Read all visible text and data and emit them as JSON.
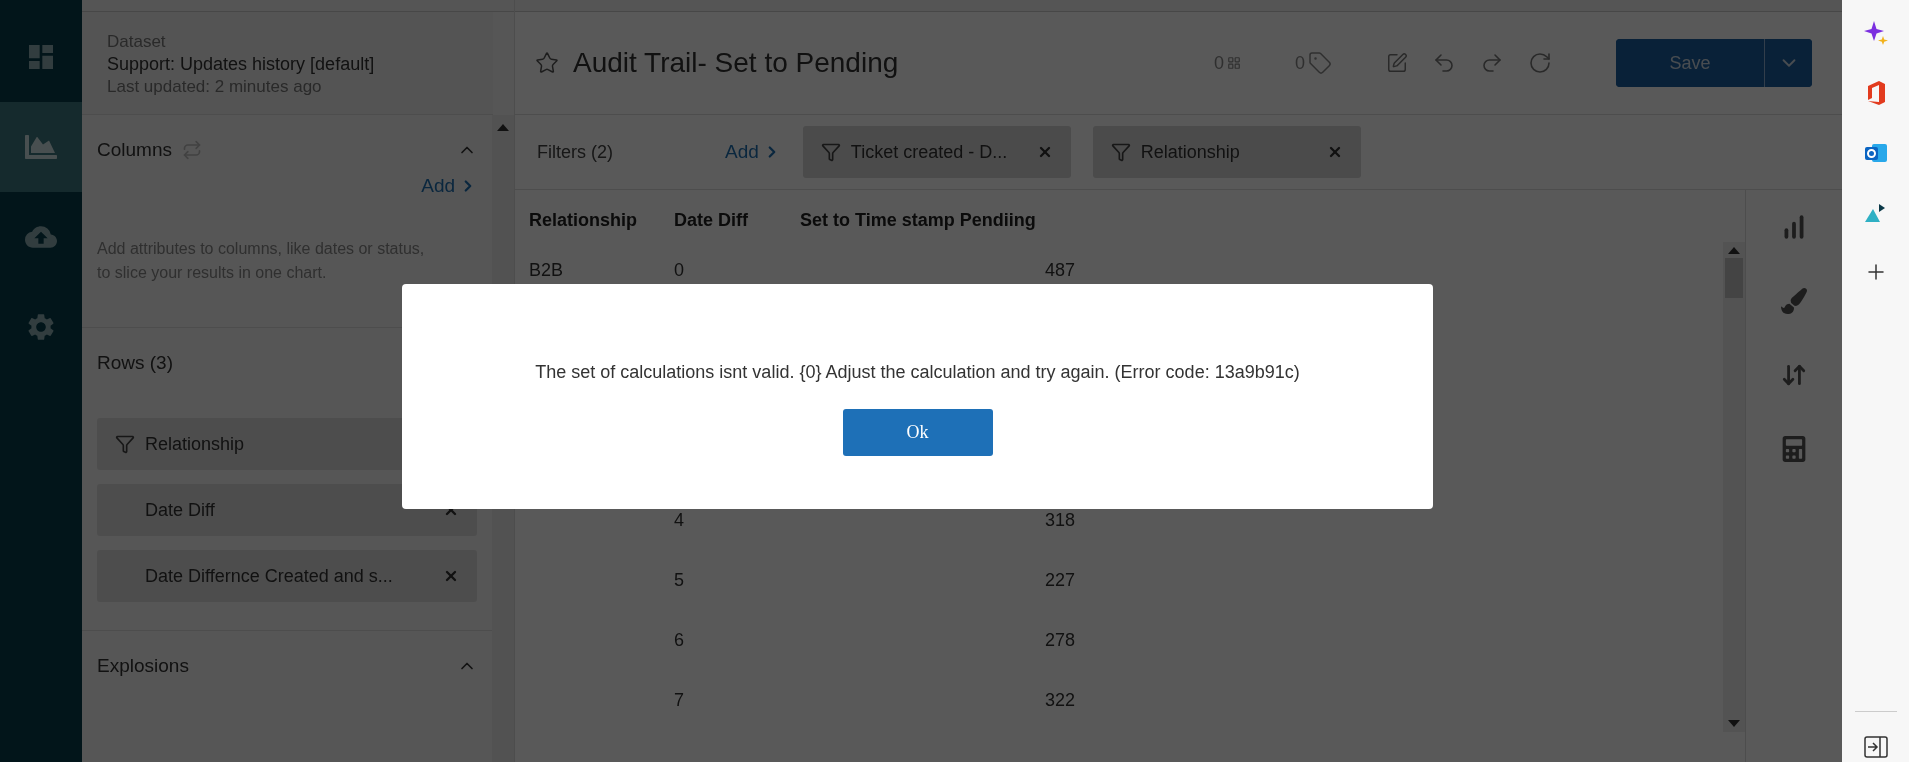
{
  "nav": [
    {
      "kind": "dashboard",
      "selected": false
    },
    {
      "kind": "chart",
      "selected": true
    },
    {
      "kind": "upload",
      "selected": false
    },
    {
      "kind": "settings",
      "selected": false
    }
  ],
  "dataset": {
    "label": "Dataset",
    "name": "Support: Updates history [default]",
    "updated": "Last updated: 2 minutes ago"
  },
  "columns_section": {
    "title": "Columns",
    "expanded": true,
    "add": "Add",
    "description": "Add attributes to columns, like dates or status, to slice your results in one chart."
  },
  "rows_section": {
    "title": "Rows (3)",
    "chips": [
      {
        "label": "Relationship",
        "filter": true
      },
      {
        "label": "Date Diff",
        "filter": false,
        "removable": true
      },
      {
        "label": "Date Differnce Created and s...",
        "filter": false,
        "removable": true
      }
    ]
  },
  "explosions_section": {
    "title": "Explosions",
    "expanded": true
  },
  "report": {
    "title": "Audit Trail- Set to Pending",
    "starred": false,
    "widgets_count": "0",
    "tags_count": "0",
    "save": "Save"
  },
  "filters": {
    "title": "Filters (2)",
    "add": "Add",
    "chips": [
      {
        "label": "Ticket created - D..."
      },
      {
        "label": "Relationship"
      }
    ]
  },
  "table": {
    "columns": [
      "Relationship",
      "Date Diff",
      "Set to Time stamp Pendiing"
    ],
    "rows": [
      {
        "relationship": "B2B",
        "date_diff": "0",
        "value": "487"
      },
      {
        "date_diff": "4",
        "value": "318"
      },
      {
        "date_diff": "5",
        "value": "227"
      },
      {
        "date_diff": "6",
        "value": "278"
      },
      {
        "date_diff": "7",
        "value": "322"
      }
    ]
  },
  "tools": [
    {
      "kind": "chart"
    },
    {
      "kind": "brush"
    },
    {
      "kind": "sort"
    },
    {
      "kind": "calculator"
    }
  ],
  "dialog": {
    "message": "The set of calculations isnt valid. {0} Adjust the calculation and try again. (Error code: 13a9b91c)",
    "button": "Ok"
  },
  "browser_sidebar": [
    {
      "kind": "copilot"
    },
    {
      "kind": "office"
    },
    {
      "kind": "mail"
    },
    {
      "kind": "triangle"
    },
    {
      "kind": "add"
    }
  ]
}
